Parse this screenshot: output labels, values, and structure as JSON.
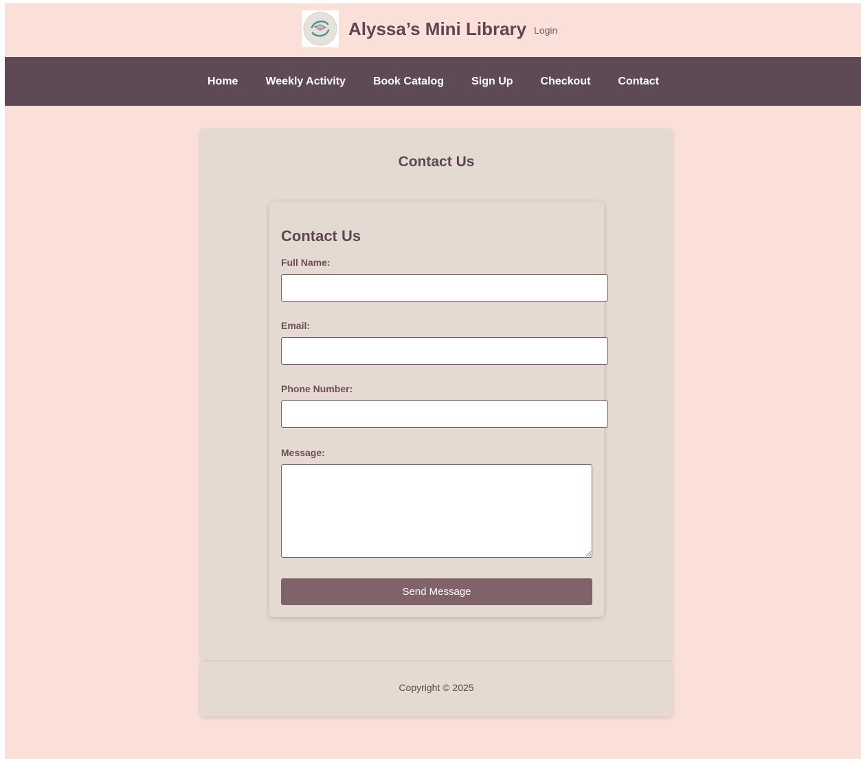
{
  "header": {
    "logo_icon": "book-globe-logo-icon",
    "site_title": "Alyssa’s Mini Library",
    "login_label": "Login"
  },
  "nav": {
    "items": [
      {
        "label": "Home"
      },
      {
        "label": "Weekly Activity"
      },
      {
        "label": "Book Catalog"
      },
      {
        "label": "Sign Up"
      },
      {
        "label": "Checkout"
      },
      {
        "label": "Contact"
      }
    ]
  },
  "main": {
    "title": "Contact Us",
    "form": {
      "title": "Contact Us",
      "full_name_label": "Full Name:",
      "full_name_value": "",
      "email_label": "Email:",
      "email_value": "",
      "phone_label": "Phone Number:",
      "phone_value": "",
      "message_label": "Message:",
      "message_value": "",
      "submit_label": "Send Message"
    }
  },
  "footer": {
    "copyright": "Copyright © 2025"
  },
  "colors": {
    "page_background": "#fbe0da",
    "nav_background": "#5e4a55",
    "card_background": "#e5dad1",
    "title_text": "#5e4653",
    "button_background": "#80626a"
  }
}
